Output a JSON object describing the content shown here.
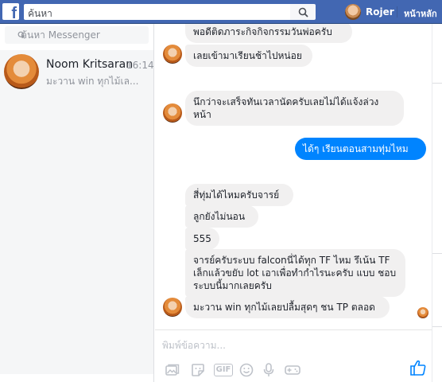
{
  "topbar": {
    "logo": "f",
    "search_placeholder": "ค้นหา",
    "user_name": "Rojer",
    "home_label": "หน้าหลัก"
  },
  "sidebar": {
    "search_placeholder": "ค้นหา Messenger",
    "conversations": [
      {
        "name": "Noom Kritsaran",
        "time": "16:14",
        "preview": "มะวาน win ทุกไม้เล..."
      }
    ]
  },
  "chat": {
    "messages": [
      {
        "direction": "in",
        "text": "พอดีติดภาระกิจกิจกรรมวันพ่อครับ"
      },
      {
        "direction": "in",
        "text": "เลยเข้ามาเรียนช้าไปหน่อย"
      },
      {
        "direction": "in",
        "text": "นึกว่าจะเสร็จทันเวลานัดครับเลยไม่ได้แจ้งล่วง หน้า"
      },
      {
        "direction": "out",
        "text": "ได้ๆ เรียนตอนสามทุ่มไหม"
      },
      {
        "direction": "in",
        "text": "สี่ทุ่มได้ไหมครับจารย์"
      },
      {
        "direction": "in",
        "text": "ลูกยังไม่นอน"
      },
      {
        "direction": "in",
        "text": "555"
      },
      {
        "direction": "in",
        "text": "จารย์ครับระบบ falconนี่ได้ทุก TF ไหม รึเน้น TF เล็กแล้วขยับ lot เอาเพื่อทำกำไรนะครับ แบบ ชอบระบบนี้มากเลยครับ"
      },
      {
        "direction": "in",
        "text": "มะวาน win ทุกไม้เลยปลื้มสุดๆ ชน TP ตลอด"
      }
    ]
  },
  "composer": {
    "placeholder": "พิมพ์ข้อความ...",
    "gif_label": "GIF"
  },
  "colors": {
    "brand_blue": "#4267b2",
    "outgoing_bubble": "#0084ff",
    "incoming_bubble": "#f1f0f0"
  }
}
